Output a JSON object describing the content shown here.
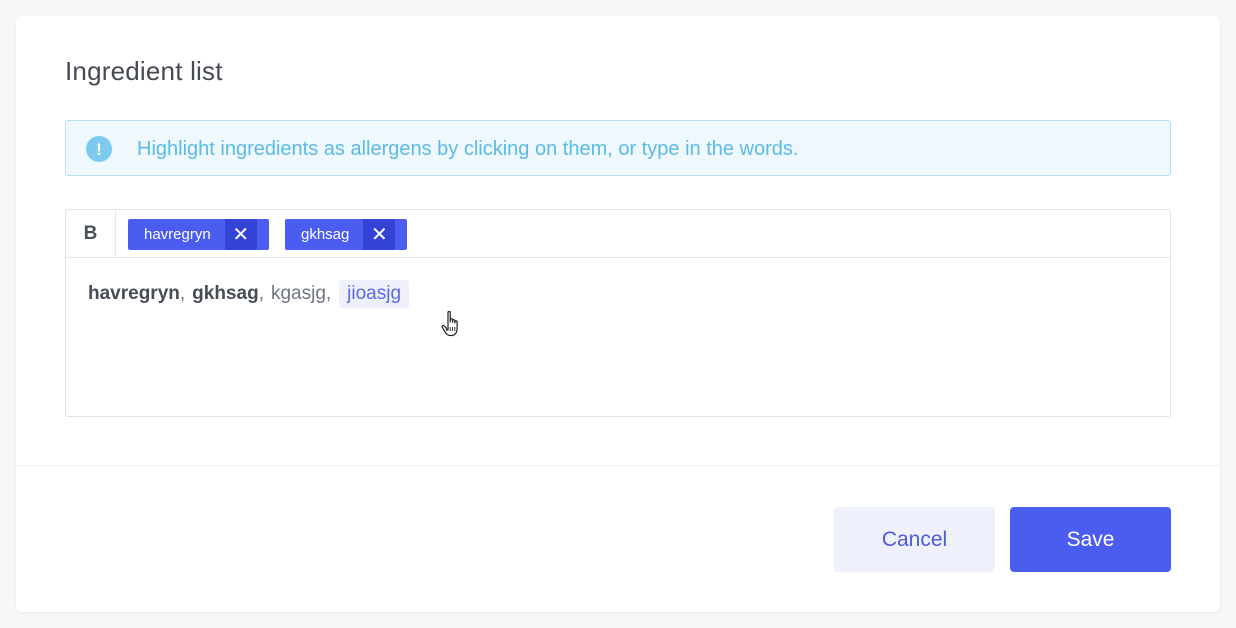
{
  "dialog": {
    "title": "Ingredient list",
    "info": {
      "icon": "info-circle-icon",
      "text": "Highlight ingredients as allergens by clicking on them, or type in the words."
    },
    "editor": {
      "toolbar": {
        "bold_label": "B",
        "tags": [
          {
            "label": "havregryn",
            "remove_icon": "close-icon",
            "remove_glyph": "✕"
          },
          {
            "label": "gkhsag",
            "remove_icon": "close-icon",
            "remove_glyph": "✕"
          }
        ]
      },
      "content": {
        "words": [
          {
            "text": "havregryn",
            "state": "bold"
          },
          {
            "text": "gkhsag",
            "state": "bold"
          },
          {
            "text": "kgasjg",
            "state": "normal"
          },
          {
            "text": "jioasjg",
            "state": "hover"
          }
        ],
        "separator": ","
      }
    },
    "footer": {
      "cancel_label": "Cancel",
      "save_label": "Save"
    }
  },
  "colors": {
    "accent": "#4b5cf0",
    "accent_dark": "#3343d6",
    "info_bg": "#eef8fd",
    "info_text": "#5bbbe6"
  }
}
